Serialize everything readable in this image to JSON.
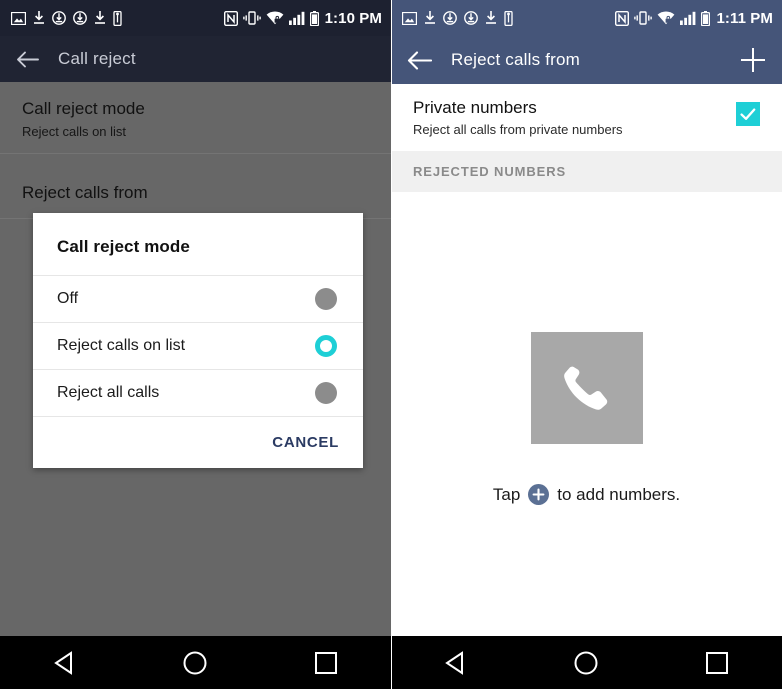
{
  "left_phone": {
    "status_bar": {
      "time": "1:10 PM",
      "left_icons": [
        "image-icon",
        "download-icon",
        "sync-icon",
        "sync-icon",
        "download-icon",
        "usb-icon"
      ],
      "right_icons": [
        "nfc-icon",
        "vibrate-icon",
        "wifi-secure-icon",
        "signal-icon",
        "battery-icon"
      ]
    },
    "app_bar": {
      "title": "Call reject",
      "back_icon": "back-arrow-icon"
    },
    "settings": [
      {
        "title": "Call reject mode",
        "subtitle": "Reject calls on list"
      },
      {
        "title": "Reject calls from",
        "subtitle": ""
      }
    ],
    "dialog": {
      "title": "Call reject mode",
      "options": [
        {
          "label": "Off",
          "selected": false
        },
        {
          "label": "Reject calls on list",
          "selected": true
        },
        {
          "label": "Reject all calls",
          "selected": false
        }
      ],
      "cancel_label": "CANCEL"
    },
    "nav_bar": {
      "back": "back-triangle-icon",
      "home": "home-circle-icon",
      "recents": "recents-square-icon"
    }
  },
  "right_phone": {
    "status_bar": {
      "time": "1:11 PM",
      "left_icons": [
        "image-icon",
        "download-icon",
        "sync-icon",
        "sync-icon",
        "download-icon",
        "usb-icon"
      ],
      "right_icons": [
        "nfc-icon",
        "vibrate-icon",
        "wifi-secure-icon",
        "signal-icon",
        "battery-icon"
      ]
    },
    "app_bar": {
      "title": "Reject calls from",
      "back_icon": "back-arrow-icon",
      "add_icon": "plus-icon"
    },
    "private_numbers": {
      "title": "Private numbers",
      "subtitle": "Reject all calls from private numbers",
      "checked": true
    },
    "section_header": "REJECTED NUMBERS",
    "empty_state": {
      "icon": "phone-handset-icon",
      "text_before": "Tap",
      "badge_icon": "plus-circle-icon",
      "text_after": "to add numbers."
    },
    "nav_bar": {
      "back": "back-triangle-icon",
      "home": "home-circle-icon",
      "recents": "recents-square-icon"
    }
  },
  "colors": {
    "accent_cyan": "#1ecfd6",
    "appbar_dark": "#202433",
    "appbar_blue": "#455579",
    "scrim_gray": "#676767",
    "cancel_text": "#2b3b63"
  }
}
